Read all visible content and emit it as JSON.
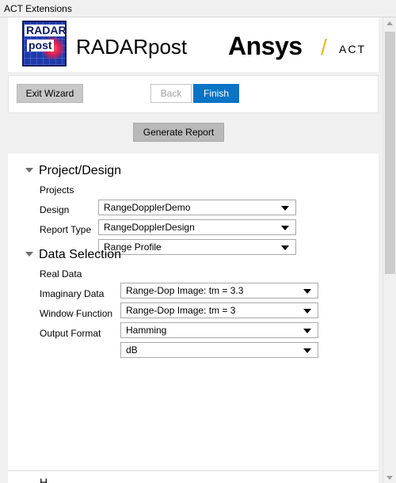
{
  "window": {
    "title": "ACT Extensions"
  },
  "header": {
    "logo_line1": "RADAR",
    "logo_line2": "post",
    "app_title": "RADARpost",
    "brand": "Ansys",
    "brand_slash": "/",
    "brand_suffix": "ACT"
  },
  "wizard": {
    "exit_label": "Exit Wizard",
    "back_label": "Back",
    "finish_label": "Finish"
  },
  "actions": {
    "generate_label": "Generate Report"
  },
  "project_design": {
    "heading": "Project/Design",
    "fields": [
      {
        "label": "Projects",
        "value": "RangeDopplerDemo"
      },
      {
        "label": "Design",
        "value": "RangeDopplerDesign"
      },
      {
        "label": "Report Type",
        "value": "Range Profile"
      }
    ]
  },
  "data_selection": {
    "heading": "Data Selection",
    "fields": [
      {
        "label": "Real Data",
        "value": "Range-Dop Image: tm = 3.3"
      },
      {
        "label": "Imaginary Data",
        "value": "Range-Dop Image: tm = 3"
      },
      {
        "label": "Window Function",
        "value": "Hamming"
      },
      {
        "label": "Output Format",
        "value": "dB"
      }
    ]
  },
  "bottom": {
    "partial_text": "H"
  },
  "colors": {
    "accent_button": "#0a74c6",
    "brand_slash": "#f0b323",
    "logo_bg": "#1f3aa8"
  }
}
